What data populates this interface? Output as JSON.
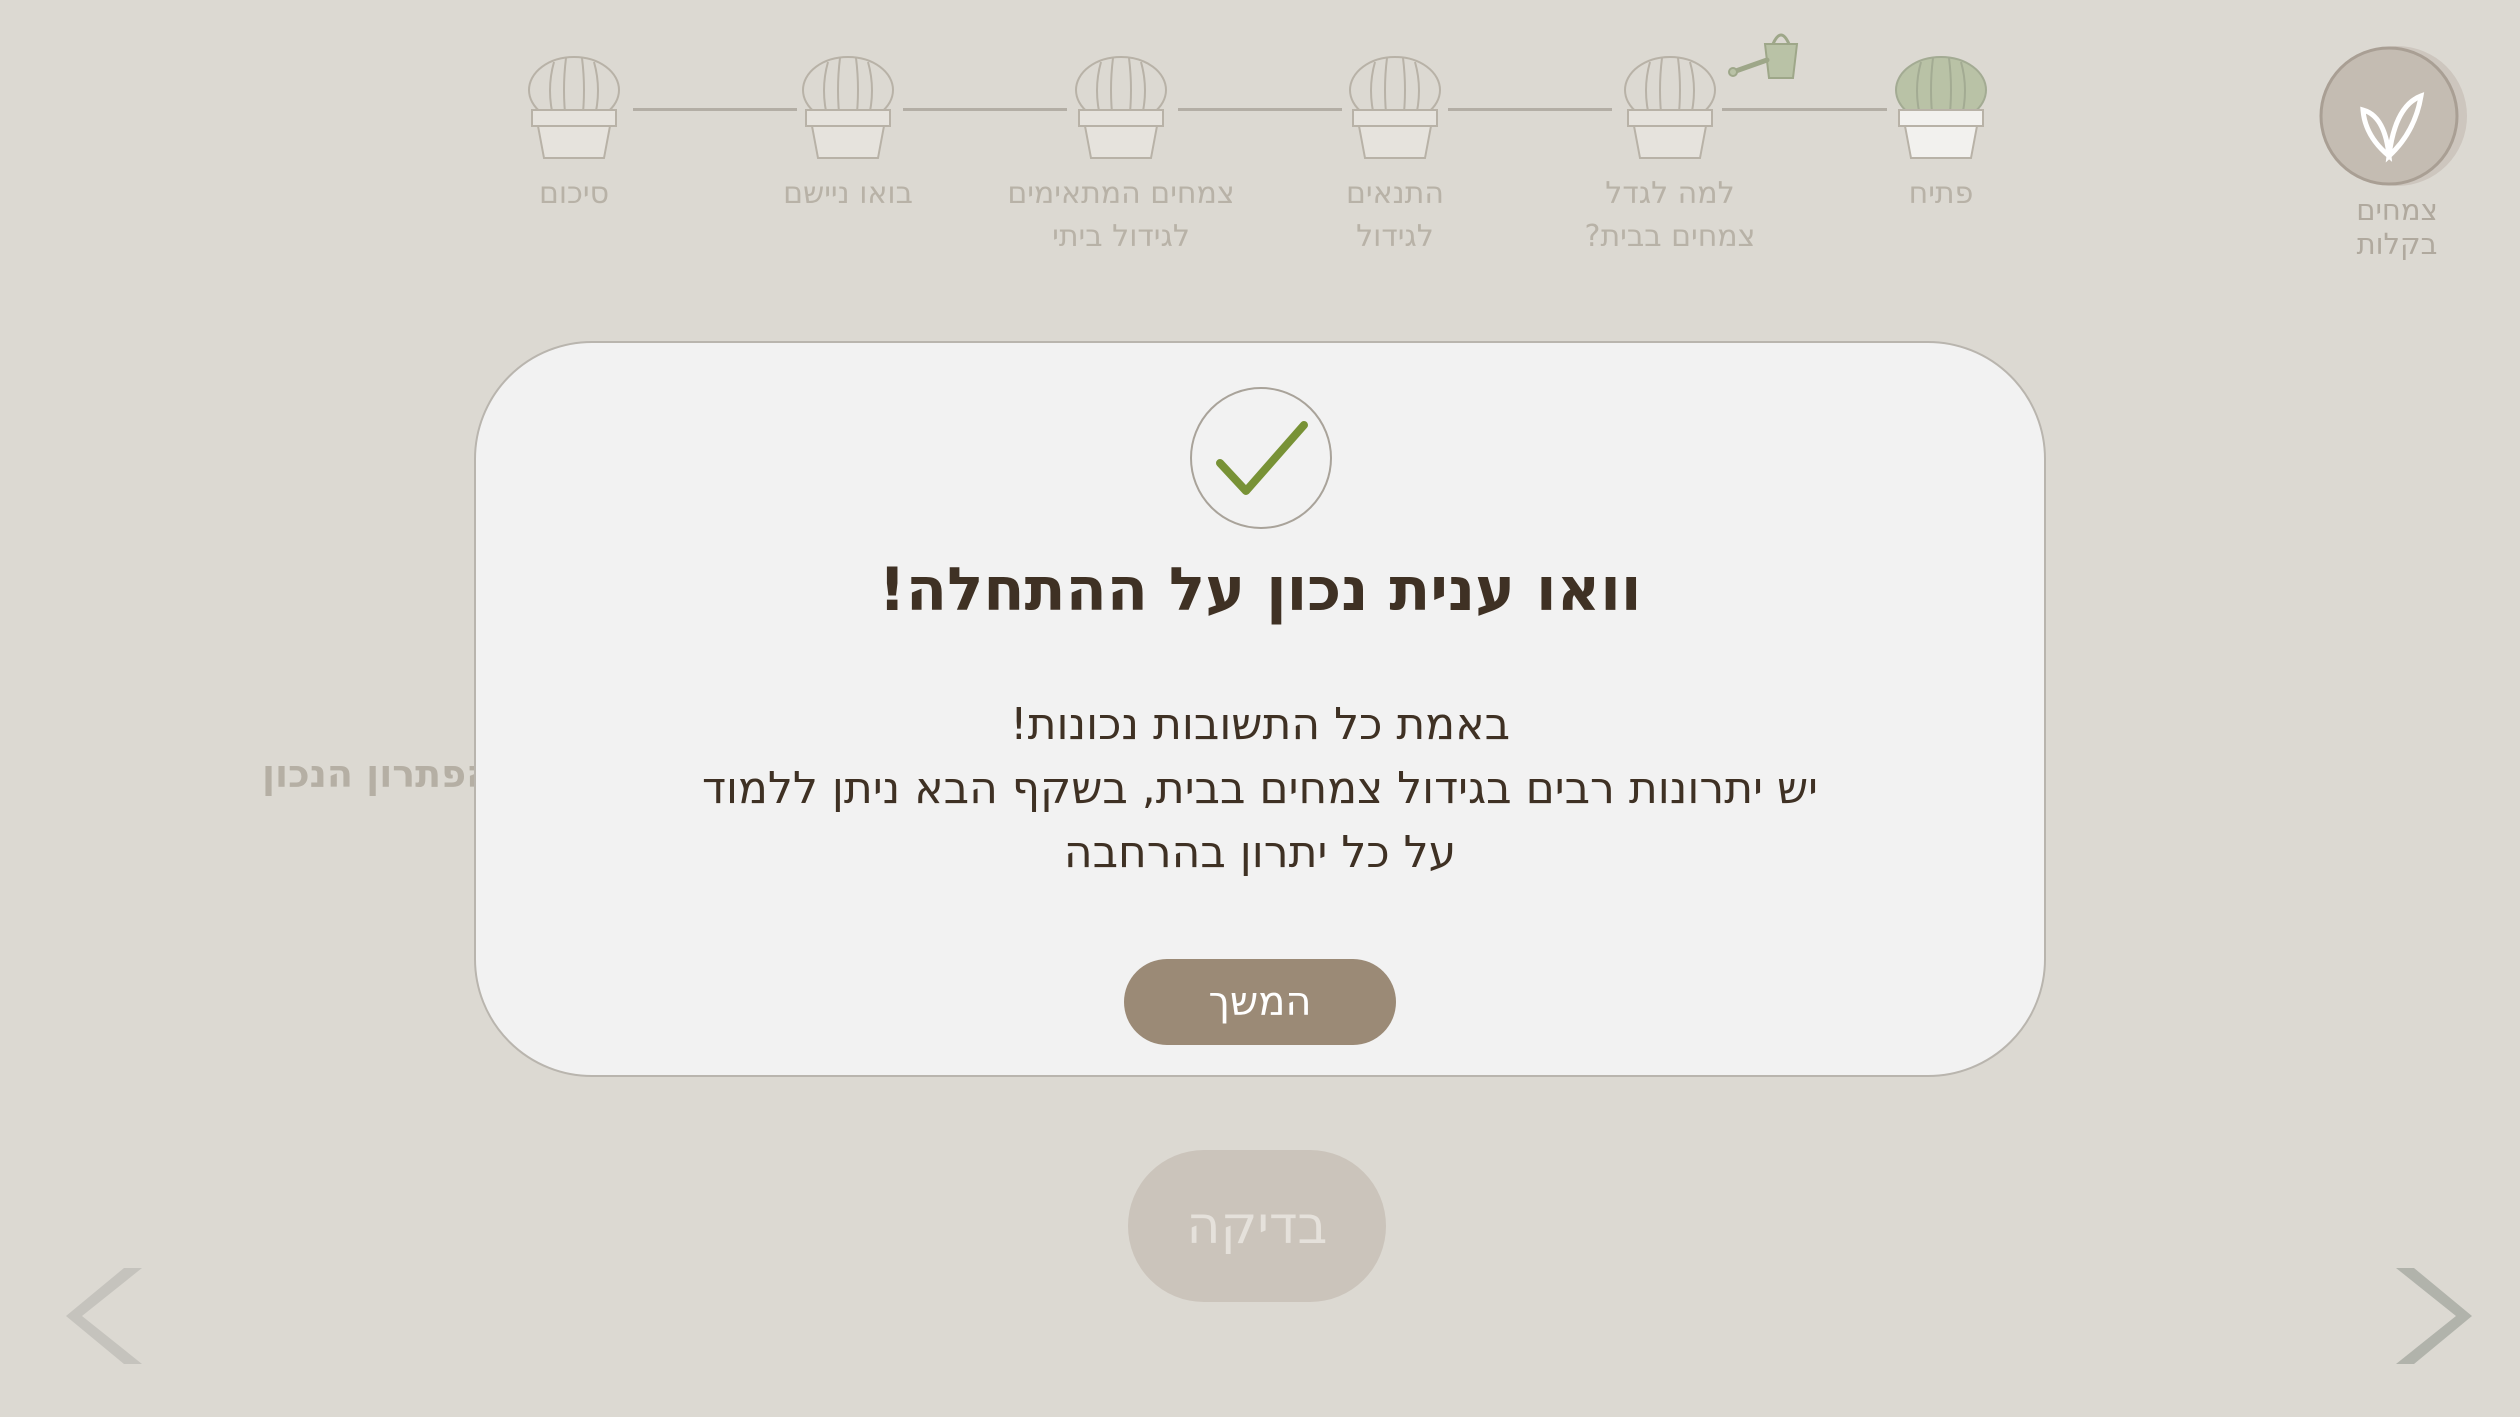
{
  "brand": {
    "label": "צמחים בקלות",
    "icon": "leaves-icon"
  },
  "steps": [
    {
      "label": "פתיח",
      "state": "active",
      "icon": "cactus-icon"
    },
    {
      "label": "למה לגדל\nצמחים בבית?",
      "state": "current",
      "icon": "cactus-icon"
    },
    {
      "label": "התנאים\nלגידול",
      "state": "upcoming",
      "icon": "cactus-icon"
    },
    {
      "label": "צמחים המתאימים\nלגידול ביתי",
      "state": "upcoming",
      "icon": "cactus-icon"
    },
    {
      "label": "בואו ניישם",
      "state": "upcoming",
      "icon": "cactus-icon"
    },
    {
      "label": "סיכום",
      "state": "upcoming",
      "icon": "cactus-icon"
    }
  ],
  "background": {
    "answer_label": "הפתרון הנכון",
    "check_button": "בדיקה"
  },
  "modal": {
    "icon": "checkmark-icon",
    "title": "וואו ענית נכון על ההתחלה!",
    "body_lines": [
      "באמת כל התשובות נכונות!",
      "יש יתרונות רבים בגידול צמחים בבית, בשקף הבא ניתן ללמוד",
      "על כל יתרון בהרחבה"
    ],
    "continue_button": "המשך"
  },
  "colors": {
    "page_bg": "#dcd9d2",
    "modal_bg": "#f2f2f2",
    "title_text": "#3f3124",
    "accent_green": "#789236",
    "button_brown": "#9b8a76"
  }
}
